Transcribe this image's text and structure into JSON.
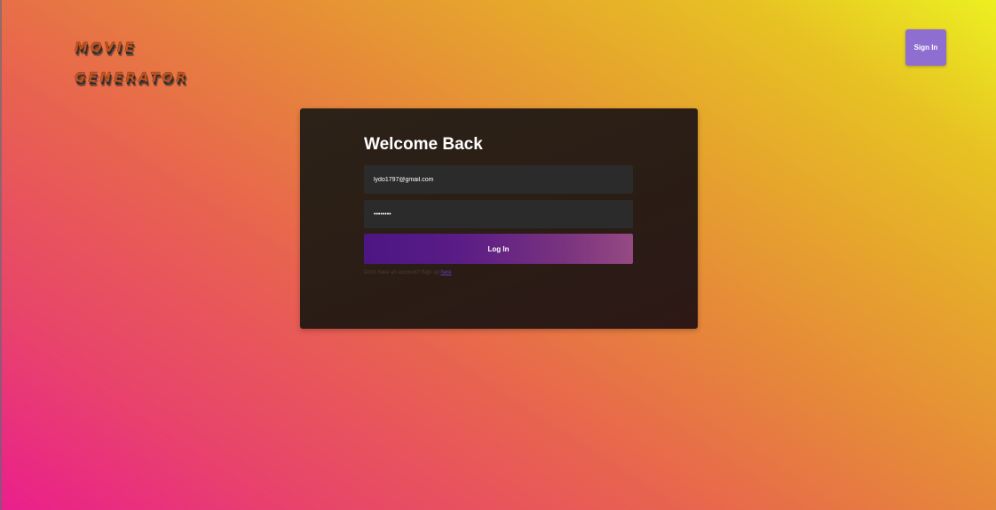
{
  "header": {
    "logo_line1": "MOVIE",
    "logo_line2": "GENERATOR",
    "sign_in_label": "Sign In"
  },
  "login": {
    "title": "Welcome Back",
    "email_value": "lydo1797@gmail.com",
    "password_value": "••••••••",
    "login_label": "Log In",
    "signup_prompt": "Don't have an account? Sign up ",
    "signup_link": "here"
  },
  "colors": {
    "button_accent": "#8f6ed2",
    "card_background": "#2b1e16",
    "login_gradient_start": "#4c1683",
    "login_gradient_end": "#964a82",
    "link": "#5a40b8"
  }
}
